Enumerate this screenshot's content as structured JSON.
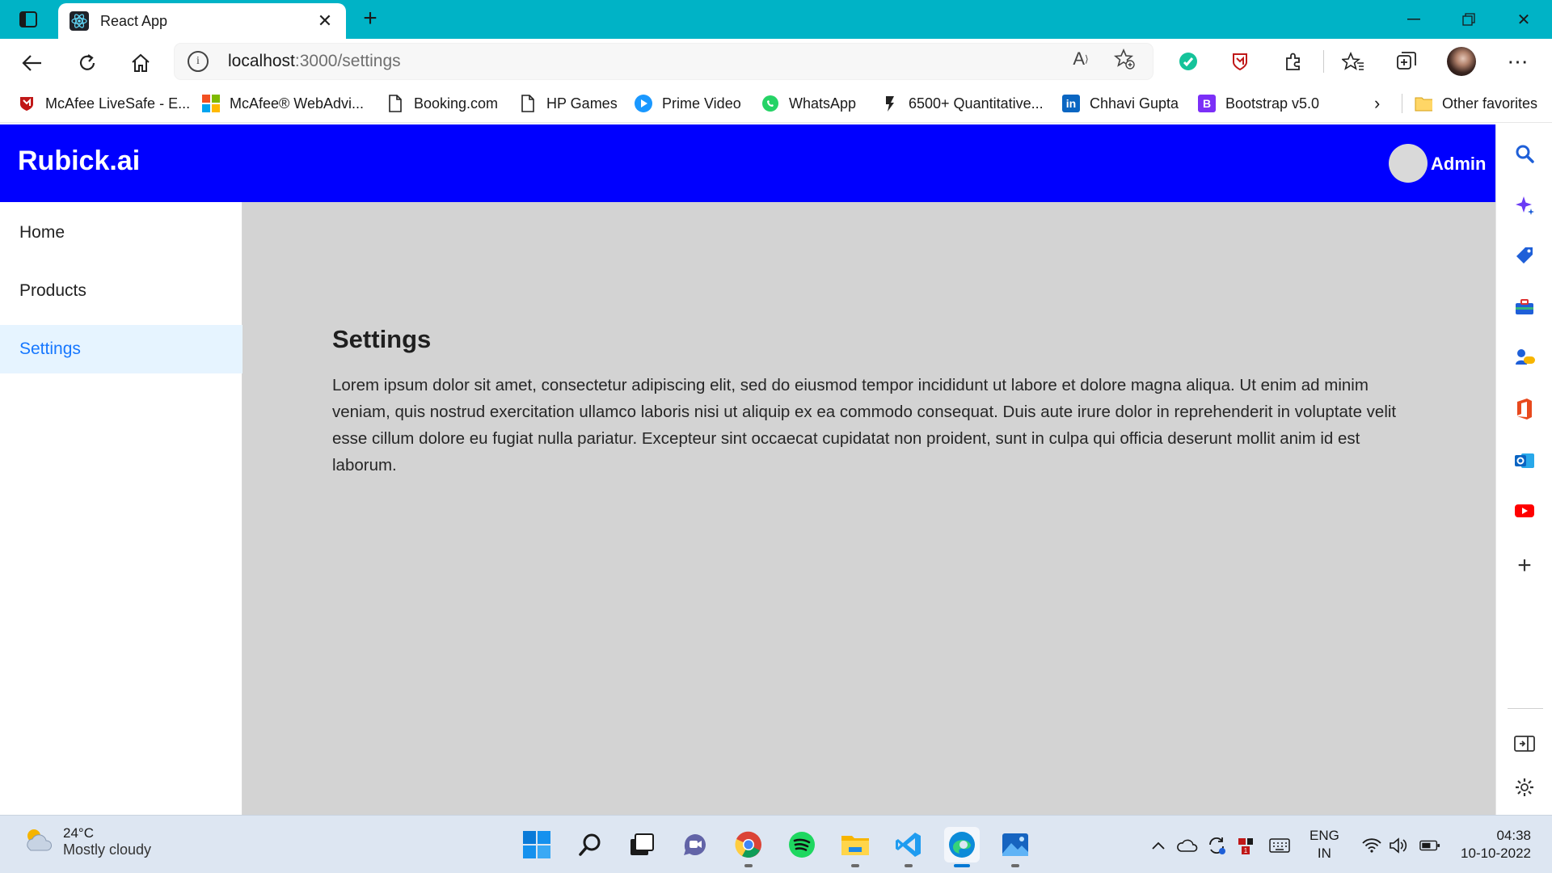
{
  "browser": {
    "tab_title": "React App",
    "url_host": "localhost",
    "url_rest": ":3000/settings",
    "favorites": [
      {
        "label": "McAfee LiveSafe - E...",
        "icon": "mcafee-icon"
      },
      {
        "label": "McAfee® WebAdvi...",
        "icon": "windows-logo-icon"
      },
      {
        "label": "Booking.com",
        "icon": "page-icon"
      },
      {
        "label": "HP Games",
        "icon": "page-icon"
      },
      {
        "label": "Prime Video",
        "icon": "prime-video-icon"
      },
      {
        "label": "WhatsApp",
        "icon": "whatsapp-icon"
      },
      {
        "label": "6500+ Quantitative...",
        "icon": "pen-icon"
      },
      {
        "label": "Chhavi Gupta",
        "icon": "linkedin-icon"
      },
      {
        "label": "Bootstrap v5.0",
        "icon": "bootstrap-icon"
      }
    ],
    "other_favorites": "Other favorites",
    "read_aloud_label": "A",
    "colors": {
      "tab_strip": "#00b3c6"
    }
  },
  "app": {
    "brand": "Rubick.ai",
    "user": "Admin",
    "header_color": "#0000ff",
    "nav": [
      {
        "label": "Home",
        "active": false
      },
      {
        "label": "Products",
        "active": false
      },
      {
        "label": "Settings",
        "active": true
      }
    ],
    "page": {
      "title": "Settings",
      "body": "Lorem ipsum dolor sit amet, consectetur adipiscing elit, sed do eiusmod tempor incididunt ut labore et dolore magna aliqua. Ut enim ad minim veniam, quis nostrud exercitation ullamco laboris nisi ut aliquip ex ea commodo consequat. Duis aute irure dolor in reprehenderit in voluptate velit esse cillum dolore eu fugiat nulla pariatur. Excepteur sint occaecat cupidatat non proident, sunt in culpa qui officia deserunt mollit anim id est laborum."
    }
  },
  "taskbar": {
    "weather_temp": "24°C",
    "weather_cond": "Mostly cloudy",
    "lang_line1": "ENG",
    "lang_line2": "IN",
    "time": "04:38",
    "date": "10-10-2022"
  }
}
